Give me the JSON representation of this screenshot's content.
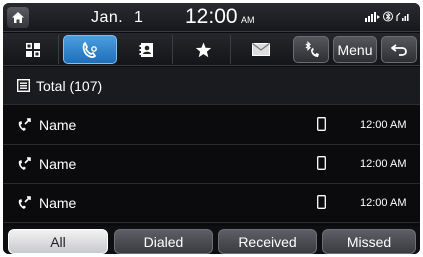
{
  "status_bar": {
    "month": "Jan.",
    "day": "1",
    "time": "12:00",
    "ampm": "AM"
  },
  "tabs": [
    {
      "icon": "keypad-icon",
      "active": false
    },
    {
      "icon": "call-history-icon",
      "active": true
    },
    {
      "icon": "contacts-icon",
      "active": false
    },
    {
      "icon": "favorites-star-icon",
      "active": false
    },
    {
      "icon": "messages-icon",
      "active": false
    }
  ],
  "toolbar": {
    "menu_label": "Menu"
  },
  "total": {
    "label": "Total (107)"
  },
  "calls": [
    {
      "name": "Name",
      "time": "12:00 AM"
    },
    {
      "name": "Name",
      "time": "12:00 AM"
    },
    {
      "name": "Name",
      "time": "12:00 AM"
    }
  ],
  "filters": {
    "all": "All",
    "dialed": "Dialed",
    "received": "Received",
    "missed": "Missed"
  },
  "colors": {
    "active_tab": "#2a85d0",
    "background": "#0b0b0d",
    "active_filter": "#e6e6e6"
  }
}
